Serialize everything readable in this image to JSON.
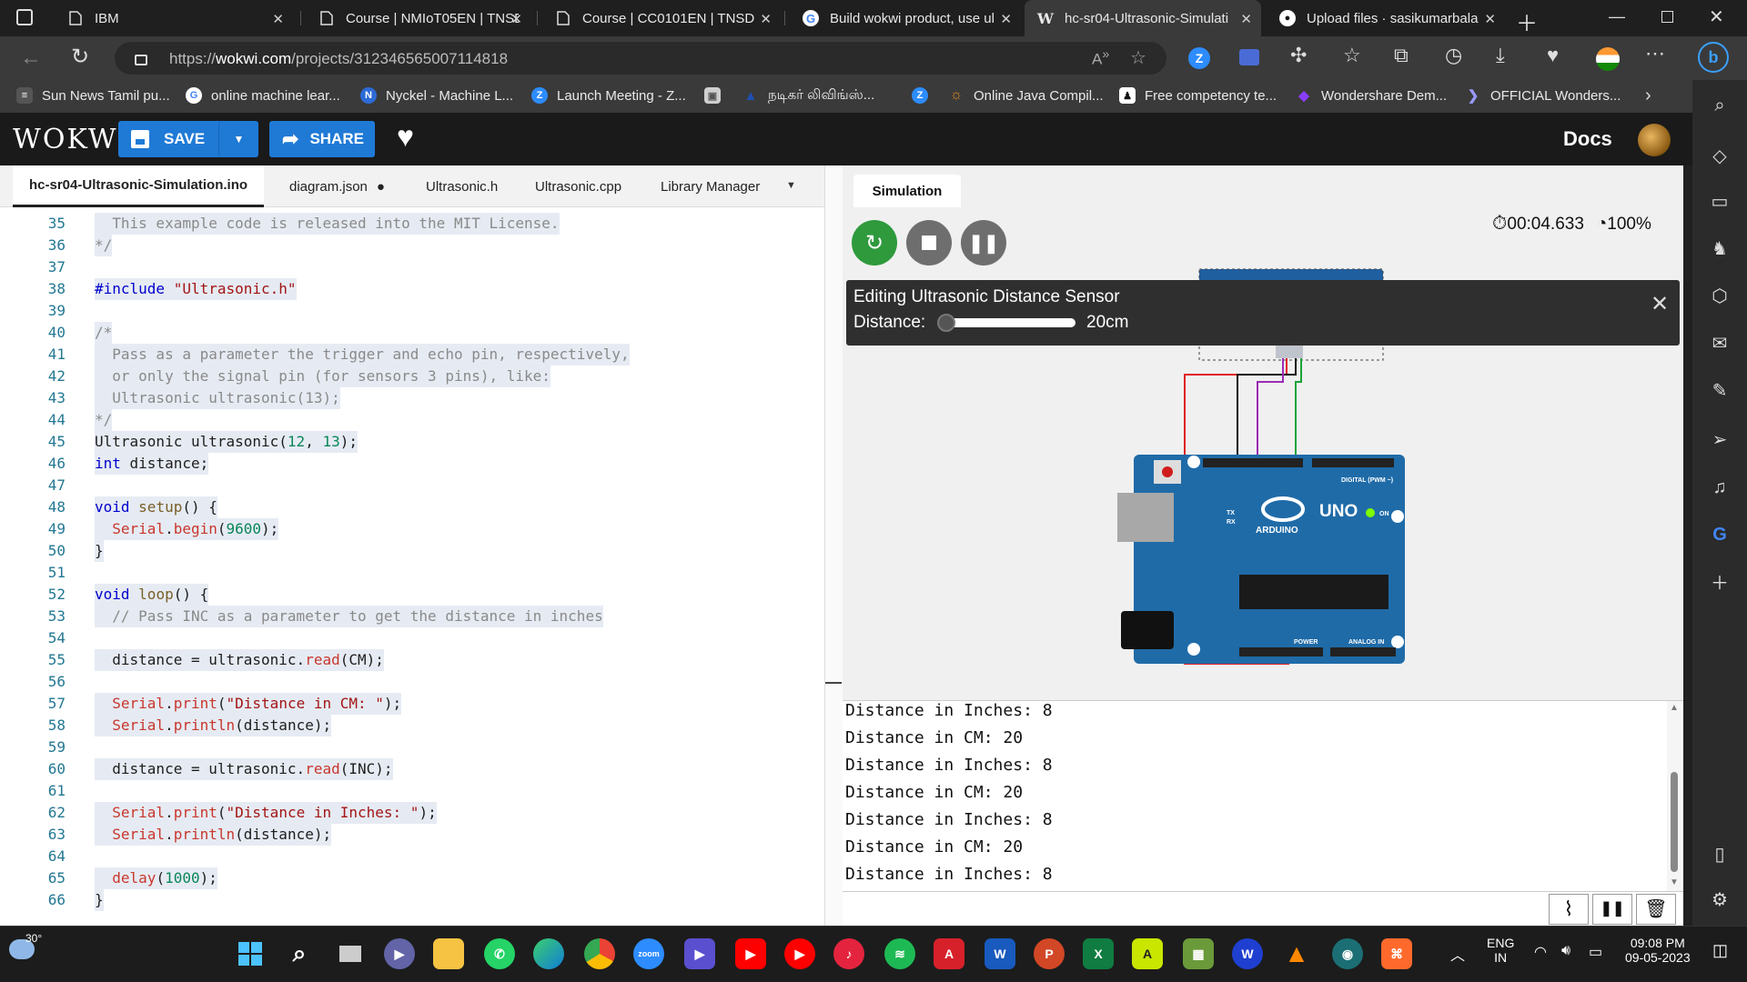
{
  "browser": {
    "tabs": [
      {
        "title": "IBM",
        "icon": "document-icon"
      },
      {
        "title": "Course | NMIoT05EN | TNSD",
        "icon": "document-icon"
      },
      {
        "title": "Course | CC0101EN | TNSD",
        "icon": "document-icon"
      },
      {
        "title": "Build wokwi product, use ul",
        "icon": "google-icon"
      },
      {
        "title": "hc-sr04-Ultrasonic-Simulati",
        "icon": "wokwi-icon"
      },
      {
        "title": "Upload files · sasikumarbala",
        "icon": "github-icon"
      }
    ],
    "url_prefix": "https://",
    "url_domain": "wokwi.com",
    "url_path": "/projects/312346565007114818",
    "bookmarks": [
      {
        "label": "Sun News Tamil pu...",
        "color": "#555555"
      },
      {
        "label": "online machine lear...",
        "color": "#4285f4"
      },
      {
        "label": "Nyckel - Machine L...",
        "color": "#2c6bd6"
      },
      {
        "label": "Launch Meeting - Z...",
        "color": "#2d8cff"
      },
      {
        "label": "",
        "color": "#cfcfcf"
      },
      {
        "label": "நடிகர் லிவிங்ஸ்...",
        "color": "#1e4fb3"
      },
      {
        "label": "",
        "color": "#2d8cff"
      },
      {
        "label": "Online Java Compil...",
        "color": "#e08a1e"
      },
      {
        "label": "Free competency te...",
        "color": "#ffffff"
      },
      {
        "label": "Wondershare Dem...",
        "color": "#8b3dff"
      },
      {
        "label": "OFFICIAL Wonders...",
        "color": "#6b6bff"
      }
    ]
  },
  "wokwi": {
    "logo": "WOKWI",
    "save_label": "SAVE",
    "share_label": "SHARE",
    "docs_label": "Docs"
  },
  "editor": {
    "tabs": [
      "hc-sr04-Ultrasonic-Simulation.ino",
      "diagram.json",
      "Ultrasonic.h",
      "Ultrasonic.cpp",
      "Library Manager"
    ],
    "unsaved_marker": "●",
    "line_numbers": [
      "35",
      "36",
      "37",
      "38",
      "39",
      "40",
      "41",
      "42",
      "43",
      "44",
      "45",
      "46",
      "47",
      "48",
      "49",
      "50",
      "51",
      "52",
      "53",
      "54",
      "55",
      "56",
      "57",
      "58",
      "59",
      "60",
      "61",
      "62",
      "63",
      "64",
      "65",
      "66"
    ]
  },
  "simulation": {
    "tab_label": "Simulation",
    "timer": "00:04.633",
    "speed": "100%",
    "popup_title": "Editing Ultrasonic Distance Sensor",
    "distance_label": "Distance:",
    "distance_value": "20cm",
    "distance_fraction": 0.05,
    "board_labels": {
      "uno": "UNO",
      "arduino": "ARDUINO",
      "digital": "DIGITAL (PWM ~)",
      "analog": "ANALOG IN",
      "power": "POWER",
      "on": "ON",
      "tx": "TX",
      "rx": "RX"
    },
    "serial_lines": [
      "Distance in Inches: 8",
      "Distance in CM: 20",
      "Distance in Inches: 8",
      "Distance in CM: 20",
      "Distance in Inches: 8",
      "Distance in CM: 20",
      "Distance in Inches: 8"
    ]
  },
  "taskbar": {
    "weather": "30°",
    "language": "ENG",
    "region": "IN",
    "time": "09:08 PM",
    "date": "09-05-2023"
  }
}
